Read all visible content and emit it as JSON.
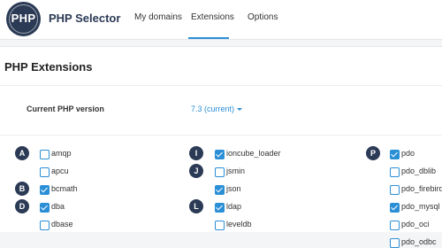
{
  "header": {
    "logo_text": "PHP",
    "app_title": "PHP Selector",
    "tabs": [
      {
        "label": "My domains",
        "active": false
      },
      {
        "label": "Extensions",
        "active": true
      },
      {
        "label": "Options",
        "active": false
      }
    ]
  },
  "page": {
    "title": "PHP Extensions",
    "version_label": "Current PHP version",
    "version_value": "7.3 (current)"
  },
  "columns": [
    {
      "groups": [
        {
          "letter": "A",
          "items": [
            {
              "name": "amqp",
              "checked": false
            },
            {
              "name": "apcu",
              "checked": false
            }
          ]
        },
        {
          "letter": "B",
          "items": [
            {
              "name": "bcmath",
              "checked": true
            }
          ]
        },
        {
          "letter": "D",
          "items": [
            {
              "name": "dba",
              "checked": true
            },
            {
              "name": "dbase",
              "checked": false
            }
          ]
        }
      ]
    },
    {
      "groups": [
        {
          "letter": "I",
          "items": [
            {
              "name": "ioncube_loader",
              "checked": true
            }
          ]
        },
        {
          "letter": "J",
          "items": [
            {
              "name": "jsmin",
              "checked": false
            },
            {
              "name": "json",
              "checked": true
            }
          ]
        },
        {
          "letter": "L",
          "items": [
            {
              "name": "ldap",
              "checked": true
            },
            {
              "name": "leveldb",
              "checked": false
            }
          ]
        }
      ]
    },
    {
      "groups": [
        {
          "letter": "P",
          "items": [
            {
              "name": "pdo",
              "checked": true
            },
            {
              "name": "pdo_dblib",
              "checked": false
            },
            {
              "name": "pdo_firebird",
              "checked": false
            },
            {
              "name": "pdo_mysql",
              "checked": true
            },
            {
              "name": "pdo_oci",
              "checked": false
            },
            {
              "name": "pdo_odbc",
              "checked": false
            }
          ]
        }
      ]
    }
  ],
  "colors": {
    "accent": "#2b8fd6",
    "navy": "#2b3a55"
  }
}
